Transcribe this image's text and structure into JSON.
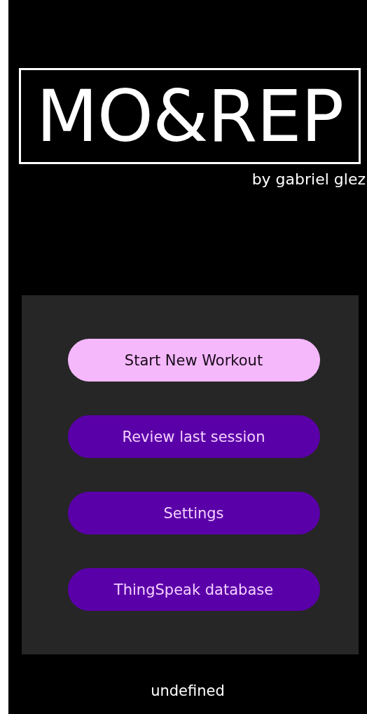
{
  "logo": {
    "title": "MO&REP",
    "byline": "by gabriel glez"
  },
  "menu": [
    {
      "label": "Start New Workout",
      "selected": true
    },
    {
      "label": "Review last session",
      "selected": false
    },
    {
      "label": "Settings",
      "selected": false
    },
    {
      "label": "ThingSpeak database",
      "selected": false
    }
  ],
  "status": "undefined"
}
